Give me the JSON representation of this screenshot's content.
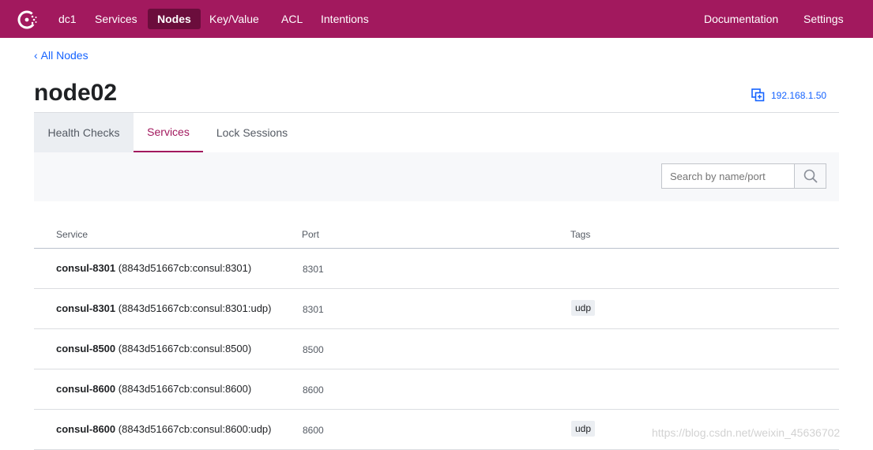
{
  "nav": {
    "datacenter": "dc1",
    "items": [
      "Services",
      "Nodes",
      "Key/Value",
      "ACL",
      "Intentions"
    ],
    "active": "Nodes",
    "right": [
      "Documentation",
      "Settings"
    ]
  },
  "breadcrumb": {
    "label": "All Nodes"
  },
  "node": {
    "name": "node02",
    "address": "192.168.1.50"
  },
  "tabs": [
    "Health Checks",
    "Services",
    "Lock Sessions"
  ],
  "active_tab": "Services",
  "search": {
    "placeholder": "Search by name/port"
  },
  "table": {
    "headers": [
      "Service",
      "Port",
      "Tags"
    ],
    "rows": [
      {
        "name": "consul-8301",
        "id": "(8843d51667cb:consul:8301)",
        "port": "8301",
        "tag": ""
      },
      {
        "name": "consul-8301",
        "id": "(8843d51667cb:consul:8301:udp)",
        "port": "8301",
        "tag": "udp"
      },
      {
        "name": "consul-8500",
        "id": "(8843d51667cb:consul:8500)",
        "port": "8500",
        "tag": ""
      },
      {
        "name": "consul-8600",
        "id": "(8843d51667cb:consul:8600)",
        "port": "8600",
        "tag": ""
      },
      {
        "name": "consul-8600",
        "id": "(8843d51667cb:consul:8600:udp)",
        "port": "8600",
        "tag": "udp"
      }
    ]
  },
  "watermark": "https://blog.csdn.net/weixin_45636702",
  "colors": {
    "brand": "#a2195e",
    "brand_dark": "#6b0d3c",
    "link": "#1563ff"
  }
}
